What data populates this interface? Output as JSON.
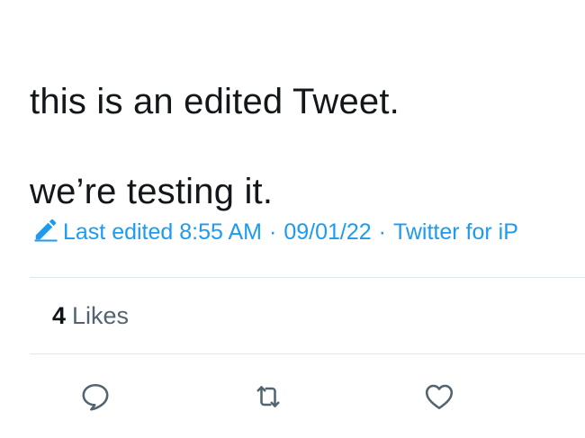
{
  "tweet": {
    "line1": "this is an edited Tweet.",
    "line2": "we’re testing it."
  },
  "meta": {
    "edited_label": "Last edited 8:55 AM",
    "separator": "·",
    "date": "09/01/22",
    "source": "Twitter for iP",
    "icon": "pencil-icon",
    "accent_color": "#1d9bf0"
  },
  "stats": {
    "likes_count": "4",
    "likes_label": "Likes"
  },
  "actions": {
    "reply_icon": "reply-icon",
    "retweet_icon": "retweet-icon",
    "like_icon": "heart-icon",
    "icon_color": "#536471"
  }
}
